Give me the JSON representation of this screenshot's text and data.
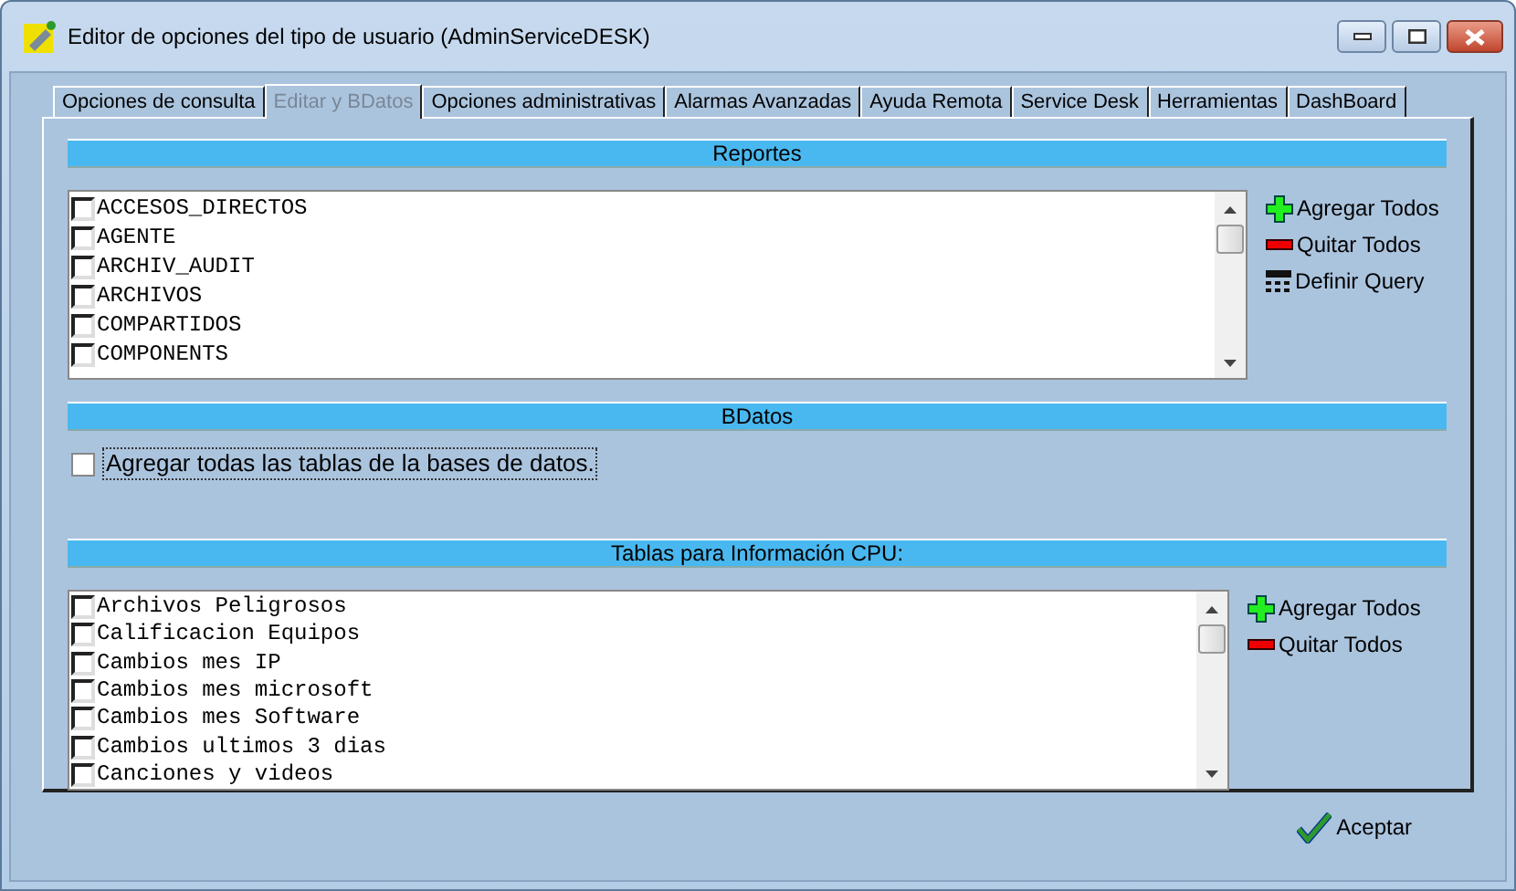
{
  "window": {
    "title": "Editor de opciones del tipo de usuario (AdminServiceDESK)"
  },
  "tabs": [
    {
      "label": "Opciones de consulta",
      "selected": false
    },
    {
      "label": "Editar y BDatos",
      "selected": true
    },
    {
      "label": "Opciones administrativas",
      "selected": false
    },
    {
      "label": "Alarmas Avanzadas",
      "selected": false
    },
    {
      "label": "Ayuda Remota",
      "selected": false
    },
    {
      "label": "Service Desk",
      "selected": false
    },
    {
      "label": "Herramientas",
      "selected": false
    },
    {
      "label": "DashBoard",
      "selected": false
    }
  ],
  "sections": [
    {
      "kind": "checklist",
      "header": "Reportes",
      "items": [
        {
          "label": "ACCESOS_DIRECTOS",
          "checked": false
        },
        {
          "label": "AGENTE",
          "checked": false
        },
        {
          "label": "ARCHIV_AUDIT",
          "checked": false
        },
        {
          "label": "ARCHIVOS",
          "checked": false
        },
        {
          "label": "COMPARTIDOS",
          "checked": false
        },
        {
          "label": "COMPONENTS",
          "checked": false
        }
      ],
      "actions": [
        {
          "kind": "add",
          "label": "Agregar Todos"
        },
        {
          "kind": "remove",
          "label": "Quitar Todos"
        },
        {
          "kind": "query",
          "label": "Definir Query"
        }
      ]
    },
    {
      "kind": "option",
      "header": "BDatos",
      "option": {
        "label": "Agregar todas las tablas de la bases de datos.",
        "checked": false
      }
    },
    {
      "kind": "checklist",
      "header": "Tablas para Información CPU:",
      "items": [
        {
          "label": "Archivos Peligrosos",
          "checked": false
        },
        {
          "label": "Calificacion Equipos",
          "checked": false
        },
        {
          "label": "Cambios mes IP",
          "checked": false
        },
        {
          "label": "Cambios mes microsoft",
          "checked": false
        },
        {
          "label": "Cambios mes Software",
          "checked": false
        },
        {
          "label": "Cambios ultimos 3 dias",
          "checked": false
        },
        {
          "label": "Canciones y videos",
          "checked": false
        }
      ],
      "actions": [
        {
          "kind": "add",
          "label": "Agregar Todos"
        },
        {
          "kind": "remove",
          "label": "Quitar Todos"
        }
      ]
    }
  ],
  "accept_button": {
    "label": "Aceptar"
  }
}
